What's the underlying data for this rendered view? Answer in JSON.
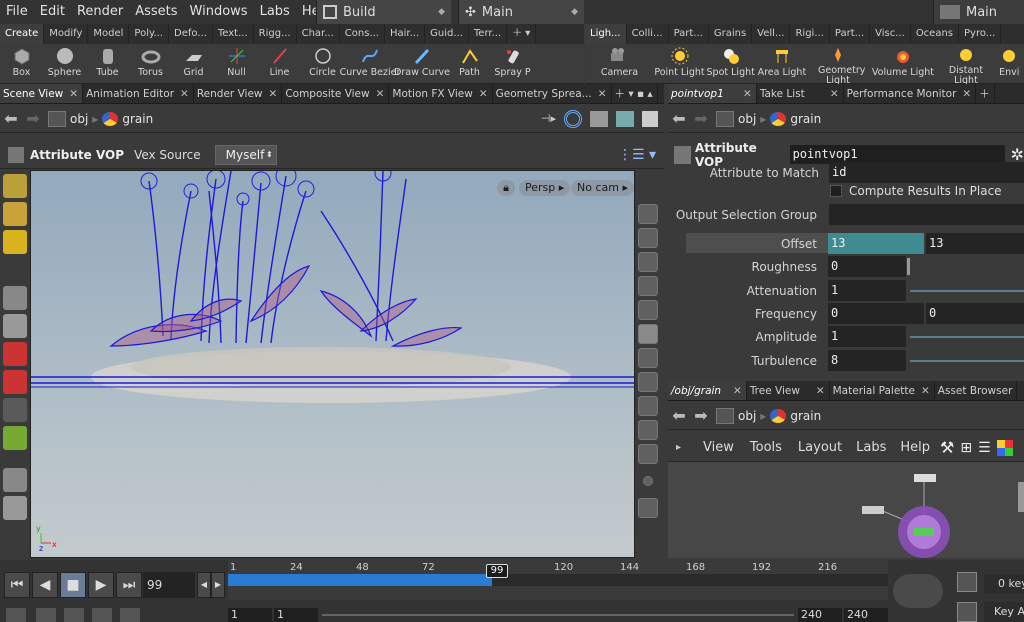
{
  "menu": [
    "File",
    "Edit",
    "Render",
    "Assets",
    "Windows",
    "Labs",
    "Help"
  ],
  "desktops": {
    "build": "Build",
    "main_left": "Main",
    "main_right": "Main"
  },
  "shelf_tabs_left": [
    "Create",
    "Modify",
    "Model",
    "Poly...",
    "Defo...",
    "Text...",
    "Rigg...",
    "Char...",
    "Cons...",
    "Hair...",
    "Guid...",
    "Terr..."
  ],
  "shelf_tabs_right": [
    "Ligh...",
    "Colli...",
    "Part...",
    "Grains",
    "Vell...",
    "Rigi...",
    "Part...",
    "Visc...",
    "Oceans",
    "Pyro..."
  ],
  "tools_left": [
    {
      "label": "Box",
      "icon": "box-icon"
    },
    {
      "label": "Sphere",
      "icon": "sphere-icon"
    },
    {
      "label": "Tube",
      "icon": "tube-icon"
    },
    {
      "label": "Torus",
      "icon": "torus-icon"
    },
    {
      "label": "Grid",
      "icon": "grid-icon"
    },
    {
      "label": "Null",
      "icon": "null-icon"
    },
    {
      "label": "Line",
      "icon": "line-icon"
    },
    {
      "label": "Circle",
      "icon": "circle-icon"
    },
    {
      "label": "Curve Bezier",
      "icon": "curve-bezier-icon"
    },
    {
      "label": "Draw Curve",
      "icon": "draw-curve-icon"
    },
    {
      "label": "Path",
      "icon": "path-icon"
    },
    {
      "label": "Spray P",
      "icon": "spray-paint-icon"
    }
  ],
  "tools_right": [
    {
      "label": "Camera",
      "icon": "camera-icon"
    },
    {
      "label": "Point Light",
      "icon": "point-light-icon"
    },
    {
      "label": "Spot Light",
      "icon": "spot-light-icon"
    },
    {
      "label": "Area Light",
      "icon": "area-light-icon"
    },
    {
      "label": "Geometry Light",
      "icon": "geometry-light-icon"
    },
    {
      "label": "Volume Light",
      "icon": "volume-light-icon"
    },
    {
      "label": "Distant Light",
      "icon": "distant-light-icon"
    },
    {
      "label": "Envi",
      "icon": "environment-light-icon"
    }
  ],
  "left_pane_tabs": [
    "Scene View",
    "Animation Editor",
    "Render View",
    "Composite View",
    "Motion FX View",
    "Geometry Sprea..."
  ],
  "right_top_tabs": [
    "pointvop1",
    "Take List",
    "Performance Monitor"
  ],
  "right_bottom_tabs": [
    "/obj/grain",
    "Tree View",
    "Material Palette",
    "Asset Browser"
  ],
  "path": {
    "obj": "obj",
    "node": "grain"
  },
  "viewport_bar": {
    "op_title": "Attribute VOP",
    "vex_source_label": "Vex Source",
    "vex_source_value": "Myself"
  },
  "viewport": {
    "persp": "Persp",
    "cam": "No cam"
  },
  "params_header": {
    "op_title": "Attribute VOP",
    "node_name": "pointvop1"
  },
  "params": {
    "attribute_to_match_label": "Attribute to Match",
    "attribute_to_match_value": "id",
    "compute_in_place": "Compute Results In Place",
    "output_group_label": "Output Selection Group",
    "offset": {
      "label": "Offset",
      "v1": "13",
      "v2": "13"
    },
    "roughness": {
      "label": "Roughness",
      "value": "0"
    },
    "attenuation": {
      "label": "Attenuation",
      "value": "1"
    },
    "frequency": {
      "label": "Frequency",
      "v1": "0",
      "v2": "0"
    },
    "amplitude": {
      "label": "Amplitude",
      "value": "1"
    },
    "turbulence": {
      "label": "Turbulence",
      "value": "8"
    }
  },
  "network_menu": [
    "View",
    "Tools",
    "Layout",
    "Labs",
    "Help"
  ],
  "timeline": {
    "current_frame": "99",
    "frame_field": "99",
    "ticks": [
      "1",
      "24",
      "48",
      "72",
      "120",
      "144",
      "168",
      "192",
      "216"
    ],
    "start1": "1",
    "start2": "1",
    "end1": "240",
    "end2": "240",
    "key_count": "0 key",
    "key_all": "Key A"
  },
  "colors": {
    "accent_blue": "#2a7bd4",
    "offset_field": "#3f8b91"
  }
}
